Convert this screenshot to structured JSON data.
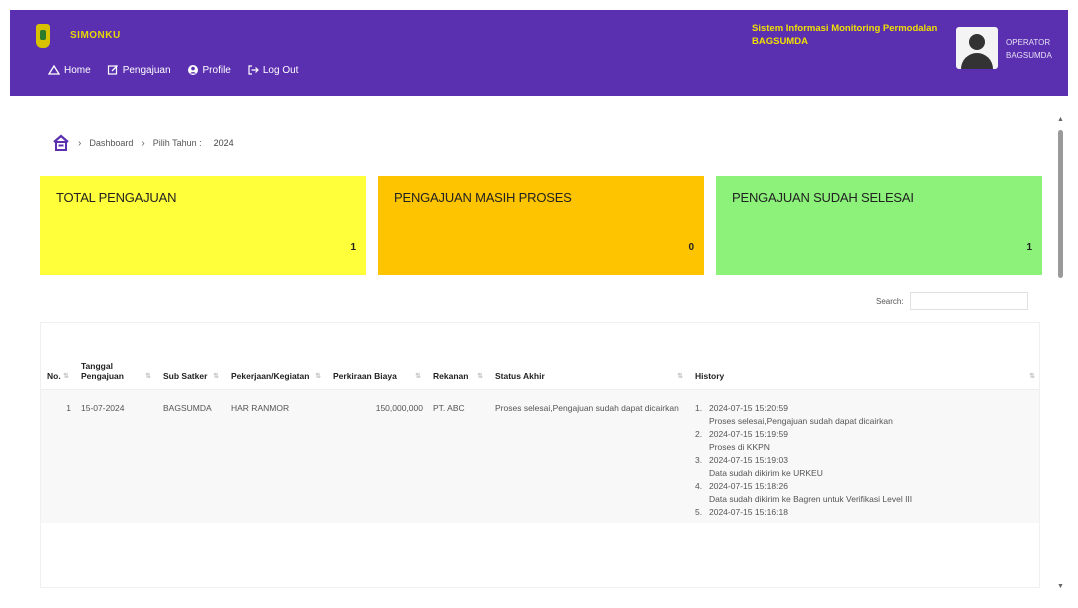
{
  "header": {
    "brand": "SIMONKU",
    "system_line1": "Sistem Informasi Monitoring Permodalan",
    "system_line2": "BAGSUMDA",
    "user_role": "OPERATOR",
    "user_unit": "BAGSUMDA",
    "menu": [
      {
        "label": "Home",
        "icon": "home-icon"
      },
      {
        "label": "Pengajuan",
        "icon": "edit-icon"
      },
      {
        "label": "Profile",
        "icon": "user-circle-icon"
      },
      {
        "label": "Log Out",
        "icon": "logout-icon"
      }
    ]
  },
  "breadcrumb": {
    "dashboard": "Dashboard",
    "pilih_tahun": "Pilih Tahun :",
    "year": "2024"
  },
  "cards": {
    "total": {
      "title": "TOTAL PENGAJUAN",
      "count": "1",
      "color": "#ffff3a"
    },
    "proses": {
      "title": "PENGAJUAN MASIH PROSES",
      "count": "0",
      "color": "#ffc400"
    },
    "selesai": {
      "title": "PENGAJUAN SUDAH SELESAI",
      "count": "1",
      "color": "#8cf27a"
    }
  },
  "search": {
    "label": "Search:",
    "value": ""
  },
  "table": {
    "headers": [
      "No.",
      "Tanggal Pengajuan",
      "Sub Satker",
      "Pekerjaan/Kegiatan",
      "Perkiraan Biaya",
      "Rekanan",
      "Status Akhir",
      "History"
    ],
    "rows": [
      {
        "no": "1",
        "tanggal": "15-07-2024",
        "satker": "BAGSUMDA",
        "kegiatan": "HAR RANMOR",
        "biaya": "150,000,000",
        "rekanan": "PT. ABC",
        "status": "Proses selesai,Pengajuan sudah dapat dicairkan",
        "history": [
          {
            "idx": "1.",
            "time": "2024-07-15 15:20:59",
            "note": "Proses selesai,Pengajuan sudah dapat dicairkan"
          },
          {
            "idx": "2.",
            "time": "2024-07-15 15:19:59",
            "note": "Proses di KKPN"
          },
          {
            "idx": "3.",
            "time": "2024-07-15 15:19:03",
            "note": "Data sudah dikirim ke URKEU"
          },
          {
            "idx": "4.",
            "time": "2024-07-15 15:18:26",
            "note": "Data sudah dikirim ke Bagren untuk Verifikasi Level III"
          },
          {
            "idx": "5.",
            "time": "2024-07-15 15:16:18",
            "note": ""
          }
        ]
      }
    ]
  }
}
